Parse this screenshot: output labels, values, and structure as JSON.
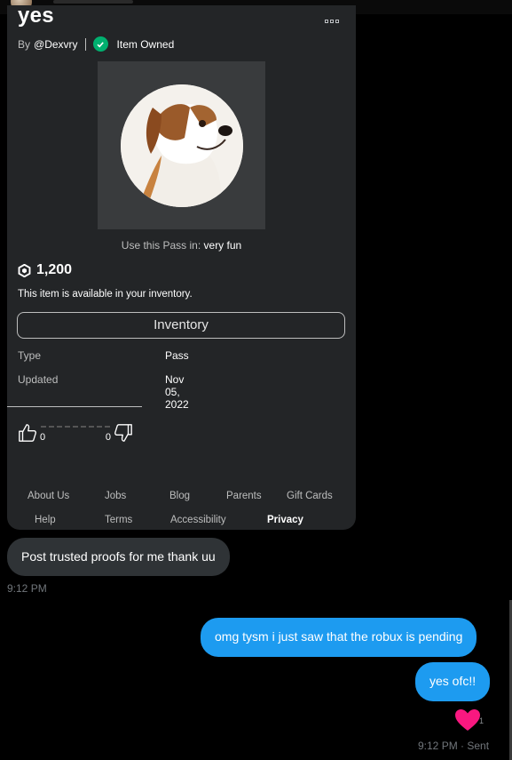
{
  "item": {
    "title": "yes",
    "by_prefix": "By",
    "creator": "@Dexvry",
    "owned_label": "Item Owned",
    "use_in_prefix": "Use this Pass in:",
    "use_in_place": "very fun",
    "price": "1,200",
    "availability": "This item is available in your inventory.",
    "inventory_button": "Inventory",
    "details": [
      {
        "label": "Type",
        "value": "Pass"
      },
      {
        "label": "Updated",
        "value": "Nov 05, 2022"
      }
    ],
    "upvotes": "0",
    "downvotes": "0"
  },
  "footer": {
    "links": [
      "About Us",
      "Jobs",
      "Blog",
      "Parents",
      "Gift Cards",
      "Help",
      "Terms",
      "Accessibility",
      "Privacy"
    ]
  },
  "chat": {
    "incoming_message": "Post trusted proofs for me thank uu",
    "incoming_time": "9:12 PM",
    "outgoing_messages": [
      "omg tysm i just saw that the robux is pending",
      "yes ofc!!"
    ],
    "reaction_count": "1",
    "outgoing_status": "9:12 PM · Sent"
  },
  "colors": {
    "background": "#000000",
    "card": "#232527",
    "owned_check": "#00b06f",
    "outgoing_bubble": "#1d9bf0",
    "incoming_bubble": "#2f3336",
    "heart": "#f91880"
  }
}
